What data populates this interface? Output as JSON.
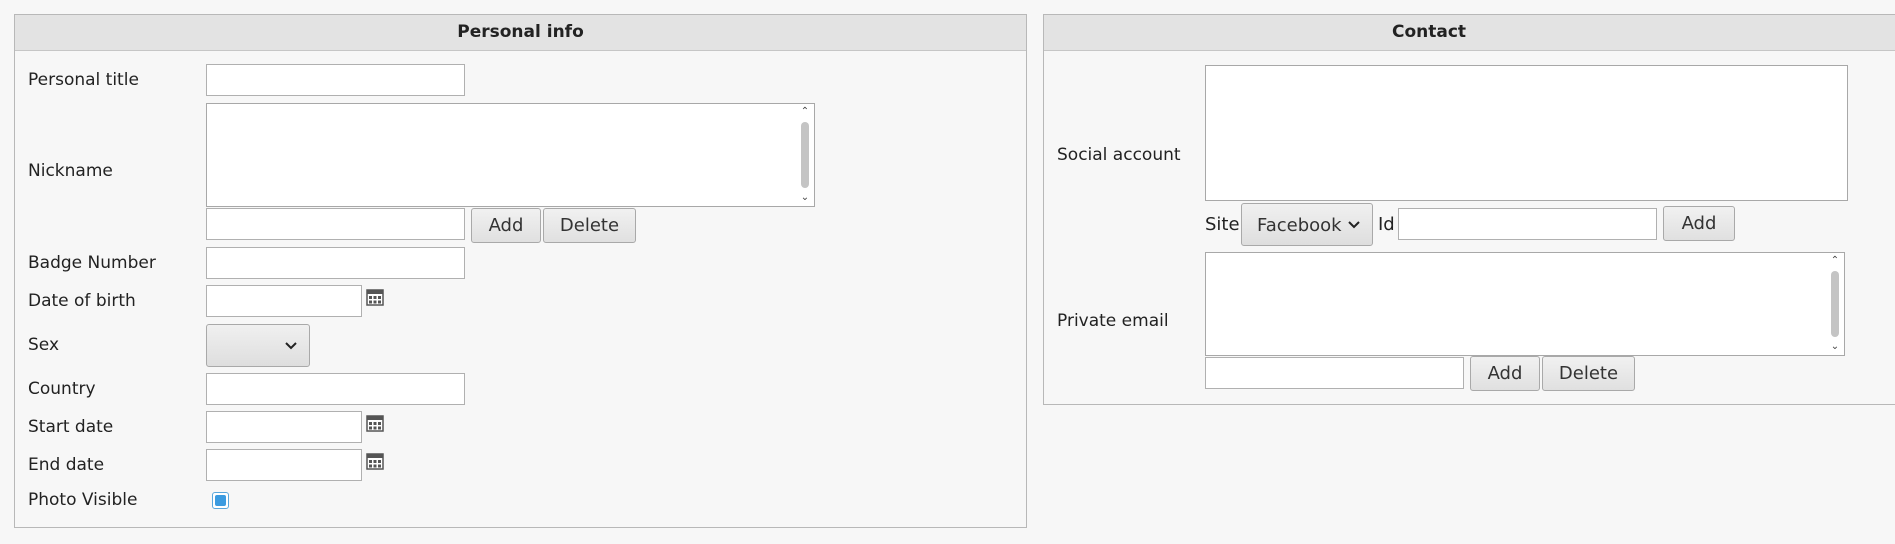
{
  "personal": {
    "title": "Personal info",
    "labels": {
      "personal_title": "Personal title",
      "nickname": "Nickname",
      "badge_number": "Badge Number",
      "date_of_birth": "Date of birth",
      "sex": "Sex",
      "country": "Country",
      "start_date": "Start date",
      "end_date": "End date",
      "photo_visible": "Photo Visible"
    },
    "values": {
      "personal_title": "",
      "nickname_new": "",
      "badge_number": "",
      "date_of_birth": "",
      "sex": "",
      "country": "",
      "start_date": "",
      "end_date": ""
    },
    "photo_visible_checked": true,
    "add_label": "Add",
    "delete_label": "Delete"
  },
  "contact": {
    "title": "Contact",
    "labels": {
      "social_account": "Social account",
      "site": "Site",
      "id": "Id",
      "private_email": "Private email"
    },
    "site_selected": "Facebook",
    "values": {
      "id": "",
      "email_new": ""
    },
    "add_label": "Add",
    "delete_label": "Delete"
  },
  "icons": {
    "calendar": "calendar-icon",
    "chevron": "chevron-down-icon",
    "scroll_up": "scroll-up-arrow-icon",
    "scroll_down": "scroll-down-arrow-icon"
  }
}
